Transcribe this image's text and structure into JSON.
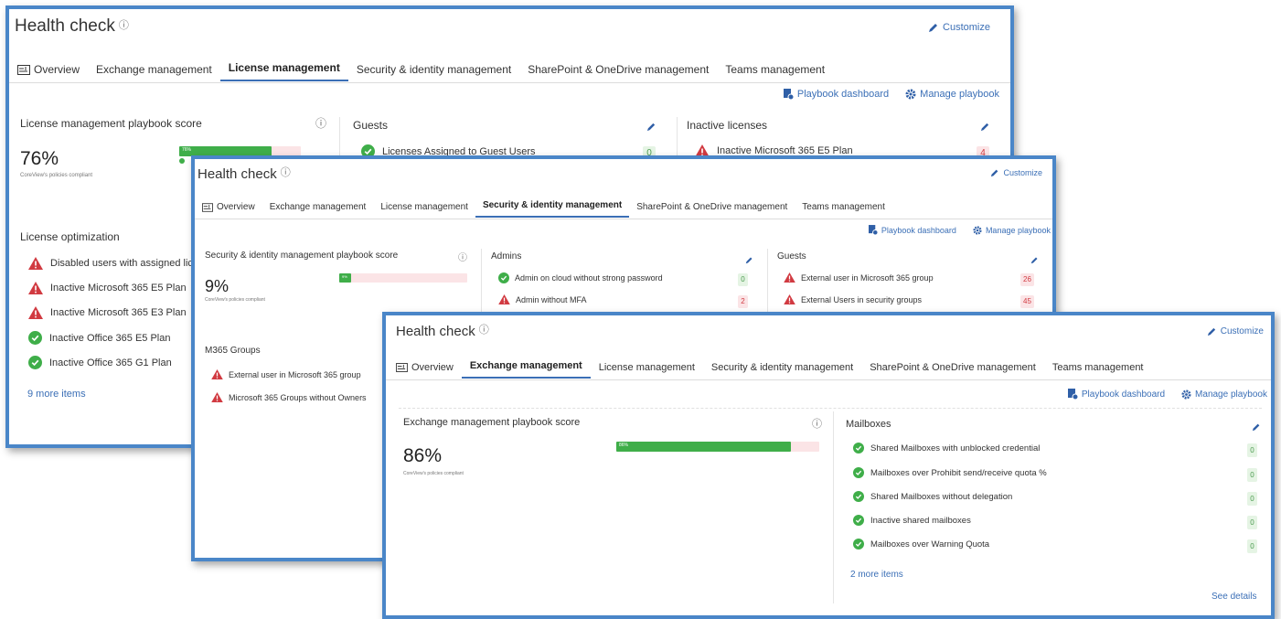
{
  "colors": {
    "accent": "#3b6fb6",
    "ok": "#3fae49",
    "error": "#d13a41",
    "frame": "#4a86c8"
  },
  "common": {
    "title": "Health check",
    "customize": "Customize",
    "playbook_dashboard": "Playbook dashboard",
    "manage_playbook": "Manage playbook",
    "compliant_caption": "CoreView's policies compliant",
    "tabs": [
      "Overview",
      "Exchange management",
      "License management",
      "Security & identity management",
      "SharePoint & OneDrive management",
      "Teams management"
    ]
  },
  "panel1": {
    "active_tab": "License management",
    "score_title": "License management playbook score",
    "score": "76%",
    "score_value": 76,
    "bar_label": "76%",
    "guests": {
      "title": "Guests",
      "items": [
        {
          "label": "Licenses Assigned to Guest Users",
          "status": "ok",
          "count": "0"
        }
      ]
    },
    "inactive": {
      "title": "Inactive licenses",
      "items": [
        {
          "label": "Inactive Microsoft 365 E5 Plan",
          "status": "error",
          "count": "4"
        }
      ]
    },
    "optimization": {
      "title": "License optimization",
      "items": [
        {
          "label": "Disabled users with assigned licen",
          "status": "error"
        },
        {
          "label": "Inactive Microsoft 365 E5 Plan",
          "status": "error"
        },
        {
          "label": "Inactive Microsoft 365 E3 Plan",
          "status": "error"
        },
        {
          "label": "Inactive Office 365 E5 Plan",
          "status": "ok"
        },
        {
          "label": "Inactive Office 365 G1 Plan",
          "status": "ok"
        }
      ],
      "more": "9 more items"
    }
  },
  "panel2": {
    "active_tab": "Security & identity management",
    "score_title": "Security & identity management playbook score",
    "score": "9%",
    "score_value": 9,
    "bar_label": "9%",
    "admins": {
      "title": "Admins",
      "items": [
        {
          "label": "Admin on cloud without strong password",
          "status": "ok",
          "count": "0"
        },
        {
          "label": "Admin without MFA",
          "status": "error",
          "count": "2"
        }
      ]
    },
    "guests": {
      "title": "Guests",
      "items": [
        {
          "label": "External user in Microsoft 365 group",
          "status": "error",
          "count": "26"
        },
        {
          "label": "External Users in security groups",
          "status": "error",
          "count": "45"
        }
      ]
    },
    "groups": {
      "title": "M365 Groups",
      "items": [
        {
          "label": "External user in Microsoft 365 group",
          "status": "error"
        },
        {
          "label": "Microsoft 365 Groups without Owners",
          "status": "error"
        }
      ]
    }
  },
  "panel3": {
    "active_tab": "Exchange management",
    "score_title": "Exchange management playbook score",
    "score": "86%",
    "score_value": 86,
    "bar_label": "86%",
    "mailboxes": {
      "title": "Mailboxes",
      "items": [
        {
          "label": "Shared Mailboxes with unblocked credential",
          "status": "ok",
          "count": "0"
        },
        {
          "label": "Mailboxes over Prohibit send/receive quota %",
          "status": "ok",
          "count": "0"
        },
        {
          "label": "Shared Mailboxes without delegation",
          "status": "ok",
          "count": "0"
        },
        {
          "label": "Inactive shared mailboxes",
          "status": "ok",
          "count": "0"
        },
        {
          "label": "Mailboxes over Warning Quota",
          "status": "ok",
          "count": "0"
        }
      ],
      "more": "2 more items",
      "see_details": "See details"
    }
  }
}
